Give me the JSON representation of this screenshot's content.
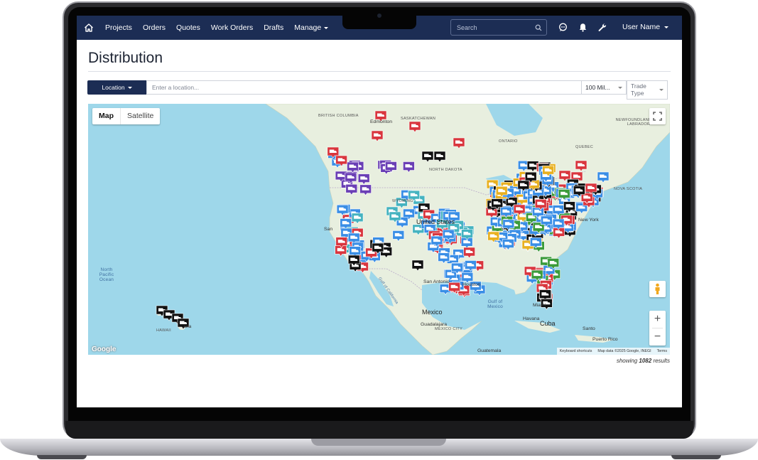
{
  "nav": {
    "items": [
      "Projects",
      "Orders",
      "Quotes",
      "Work Orders",
      "Drafts"
    ],
    "manage_label": "Manage",
    "search_placeholder": "Search",
    "user_name": "User Name"
  },
  "page": {
    "title": "Distribution"
  },
  "filters": {
    "location_label": "Location",
    "location_placeholder": "Enter a location...",
    "distance_value": "100 Mil...",
    "trade_type_placeholder": "Trade Type"
  },
  "map": {
    "type_map": "Map",
    "type_satellite": "Satellite",
    "zoom_in": "+",
    "zoom_out": "−",
    "google": "Google",
    "attribution_shortcuts": "Keyboard shortcuts",
    "attribution_data": "Map data ©2025 Google, INEGI",
    "attribution_terms": "Terms",
    "labels": {
      "british_columbia": "BRITISH COLUMBIA",
      "saskatchewan": "SASKATCHEWAN",
      "edmonton": "Edmonton",
      "ontario": "ONTARIO",
      "quebec": "QUEBEC",
      "newfoundland": "NEWFOUNDLAND AND LABRADOR",
      "nova_scotia": "NOVA SCOTIA",
      "north_dakota": "NORTH DAKOTA",
      "wyoming": "WYOMING",
      "united_states": "United States",
      "new_york": "New York",
      "san_antonio": "San Antonio",
      "houston": "Houston",
      "mexico": "Mexico",
      "guadalajara": "Guadalajara",
      "mexico_city": "MEXICO CITY",
      "havana": "Havana",
      "cuba": "Cuba",
      "miami": "Miami",
      "santo": "Santo",
      "puerto_rico": "Puerto Rico",
      "guatemala": "Guatemala",
      "north_pacific": "North Pacific Ocean",
      "gulf_of_mexico": "Gulf of Mexico",
      "gulf_of_california": "Gulf of California",
      "hawaii": "HAWAII",
      "san": "San",
      "ana": "ana"
    }
  },
  "results": {
    "prefix": "showing",
    "count": "1082",
    "suffix": "results"
  },
  "colors": {
    "navy": "#1c2d54",
    "marker_blue": "#3a8ee6",
    "marker_red": "#d9363e",
    "marker_purple": "#6a3fb5",
    "marker_black": "#111111",
    "marker_green": "#3b9b3b",
    "marker_yellow": "#e8b020",
    "marker_teal": "#45b3c0",
    "water": "#9ed7ea",
    "land": "#e6eedc"
  }
}
